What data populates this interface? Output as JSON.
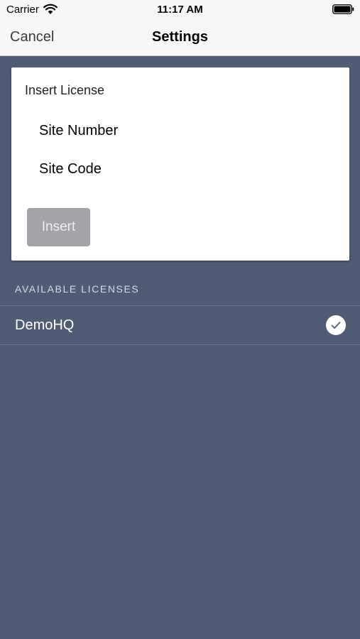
{
  "status_bar": {
    "carrier": "Carrier",
    "time": "11:17 AM",
    "wifi_icon": "wifi-icon",
    "battery_icon": "battery-full-icon"
  },
  "nav": {
    "cancel_label": "Cancel",
    "title": "Settings"
  },
  "insert_license": {
    "title": "Insert License",
    "site_number_placeholder": "Site Number",
    "site_code_placeholder": "Site Code",
    "site_number_value": "",
    "site_code_value": "",
    "insert_label": "Insert"
  },
  "licenses": {
    "header": "AVAILABLE LICENSES",
    "items": [
      {
        "name": "DemoHQ",
        "selected": true,
        "icon": "checkmark-circle-icon"
      }
    ]
  },
  "colors": {
    "background": "#505c73",
    "card": "#ffffff",
    "button_disabled": "#a3a4a8",
    "nav_bar": "#f7f7f7"
  }
}
